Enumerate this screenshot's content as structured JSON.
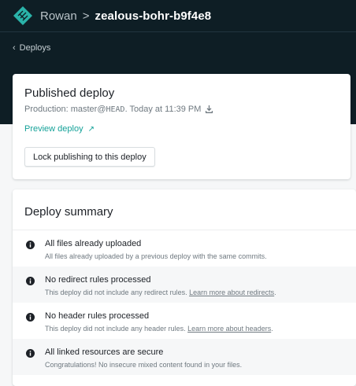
{
  "header": {
    "team": "Rowan",
    "separator": ">",
    "site": "zealous-bohr-b9f4e8",
    "back_label": "Deploys"
  },
  "published": {
    "title": "Published deploy",
    "production_prefix": "Production: master@",
    "ref": "HEAD",
    "when": ". Today at 11:39 PM",
    "preview_label": "Preview deploy",
    "preview_icon": "external-arrow-icon",
    "lock_label": "Lock publishing to this deploy"
  },
  "summary": {
    "title": "Deploy summary",
    "rows": [
      {
        "title": "All files already uploaded",
        "desc": "All files already uploaded by a previous deploy with the same commits.",
        "link": ""
      },
      {
        "title": "No redirect rules processed",
        "desc": "This deploy did not include any redirect rules. ",
        "link": "Learn more about redirects",
        "tail": "."
      },
      {
        "title": "No header rules processed",
        "desc": "This deploy did not include any header rules. ",
        "link": "Learn more about headers",
        "tail": "."
      },
      {
        "title": "All linked resources are secure",
        "desc": "Congratulations! No insecure mixed content found in your files.",
        "link": ""
      }
    ]
  },
  "colors": {
    "header_bg": "#0e1e25",
    "accent_teal": "#15a299",
    "page_bg": "#f6f7f8"
  }
}
